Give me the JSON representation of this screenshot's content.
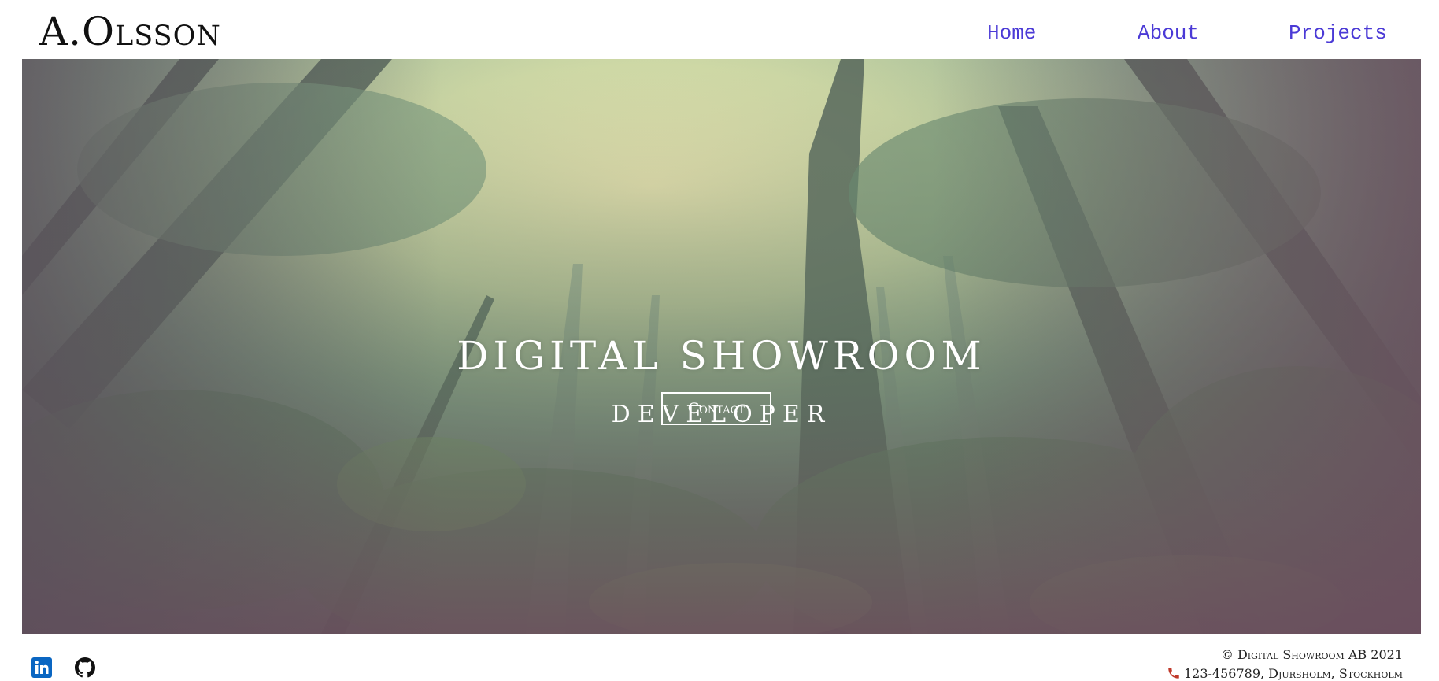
{
  "header": {
    "logo": "A.Olsson",
    "nav": {
      "home": "Home",
      "about": "About",
      "projects": "Projects"
    }
  },
  "hero": {
    "title": "DIGITAL SHOWROOM",
    "subtitle": "DEVELOPER",
    "contact_button": "Contact"
  },
  "footer": {
    "social": [
      "linkedin-icon",
      "github-icon"
    ],
    "copyright": "© Digital Showroom AB 2021",
    "address": "123-456789, Djursholm, Stockholm",
    "phone_icon": "phone-icon"
  },
  "colors": {
    "nav_link": "#4b3ad6",
    "linkedin": "#0a66c2",
    "phone": "#c0392b"
  }
}
